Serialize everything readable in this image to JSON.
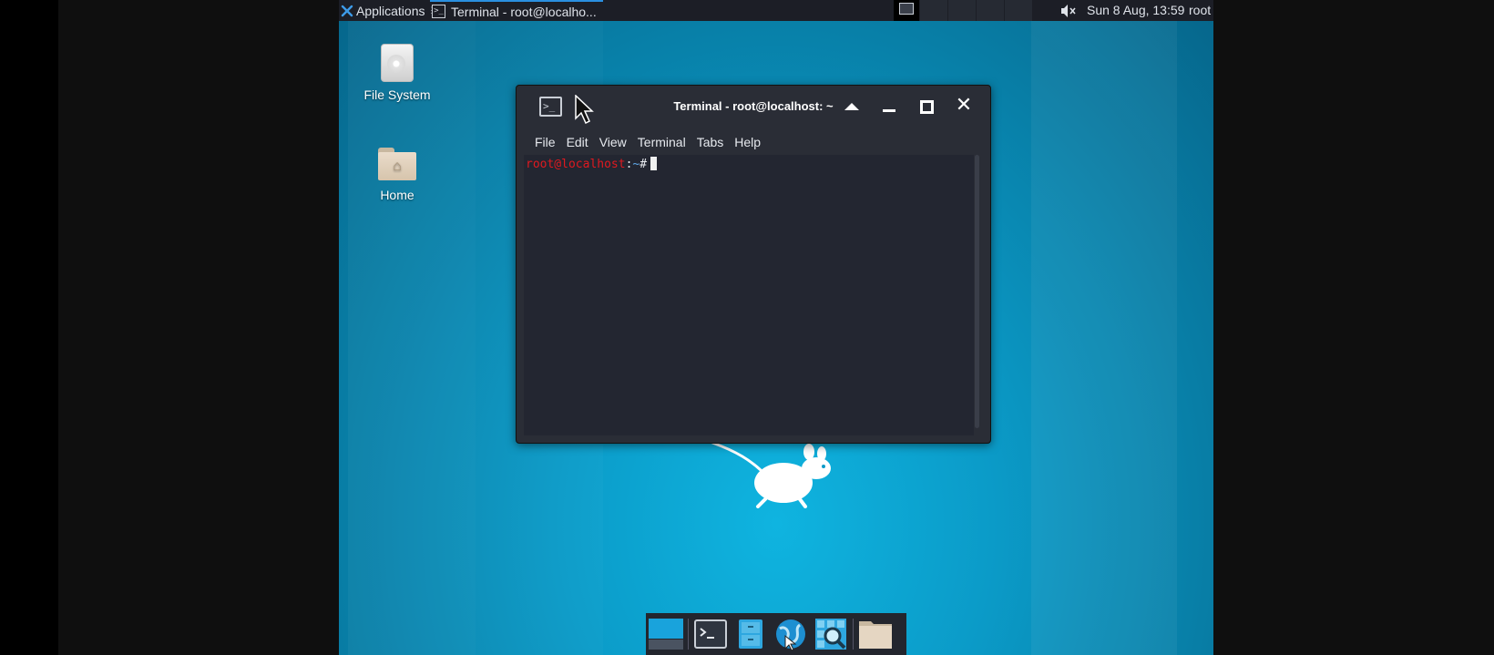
{
  "panel": {
    "applications_label": "Applications",
    "task_label": "Terminal - root@localho...",
    "clock": "Sun  8 Aug, 13:59",
    "user": "root"
  },
  "desktop": {
    "icons": [
      {
        "label": "File System",
        "icon": "drive-icon"
      },
      {
        "label": "Home",
        "icon": "home-folder-icon"
      }
    ]
  },
  "terminal": {
    "title": "Terminal - root@localhost: ~",
    "menu": [
      "File",
      "Edit",
      "View",
      "Terminal",
      "Tabs",
      "Help"
    ],
    "prompt_user": "root@localhost",
    "prompt_sep": ":",
    "prompt_path": "~",
    "prompt_char": "#"
  },
  "dock": {
    "items": [
      "show-desktop-icon",
      "terminal-icon",
      "file-manager-icon",
      "web-browser-icon",
      "app-finder-icon",
      "folder-icon"
    ]
  },
  "colors": {
    "accent": "#2a8fe0",
    "prompt_user": "#e0191f",
    "prompt_path": "#5fa8e8"
  }
}
